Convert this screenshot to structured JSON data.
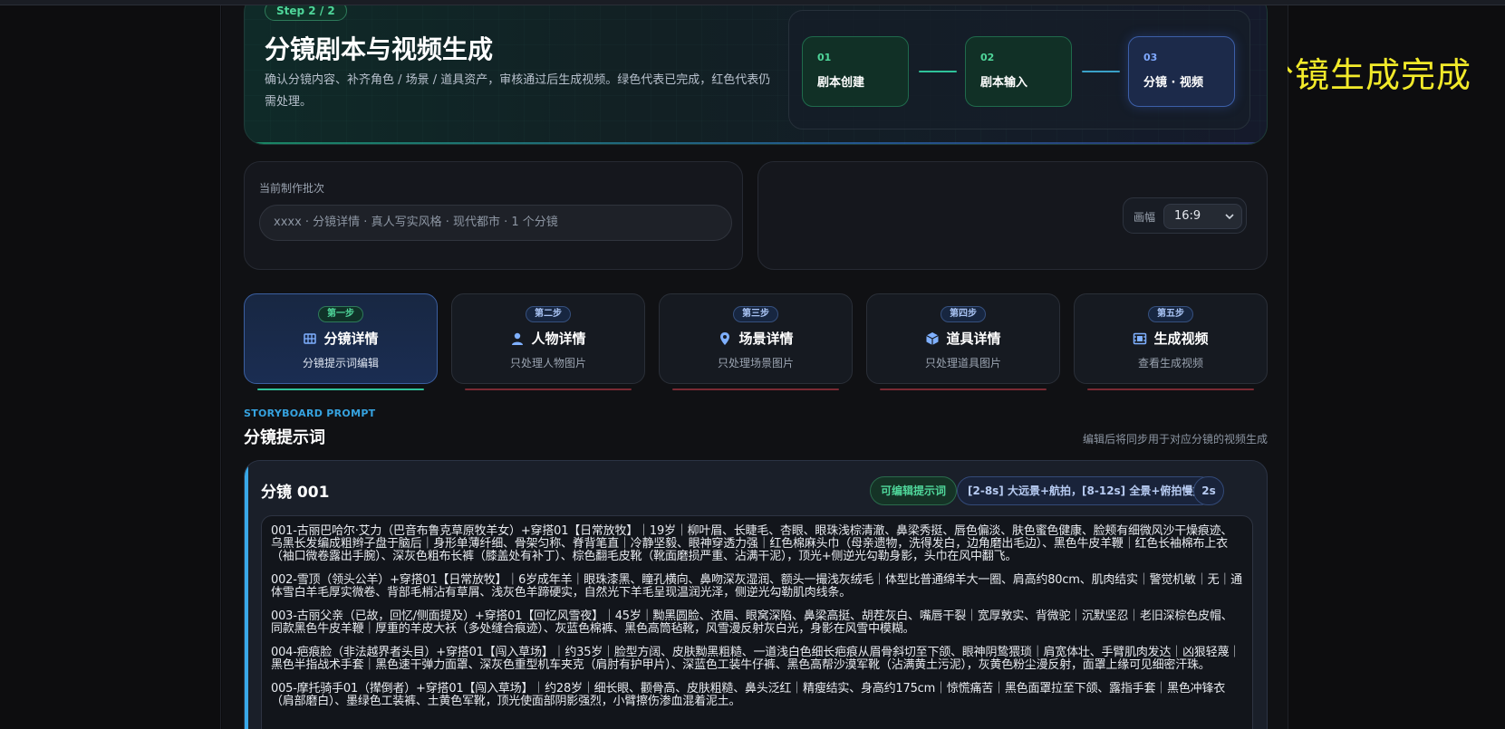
{
  "overlay_caption": "分镜生成完成",
  "hero": {
    "step_pill": "Step 2 / 2",
    "title": "分镜剧本与视频生成",
    "description": "确认分镜内容、补齐角色 / 场景 / 道具资产，审核通过后生成视频。绿色代表已完成，红色代表仍需处理。",
    "steps": [
      {
        "num": "01",
        "label": "剧本创建",
        "status": "done"
      },
      {
        "num": "02",
        "label": "剧本输入",
        "status": "done"
      },
      {
        "num": "03",
        "label": "分镜 · 视频",
        "status": "active"
      }
    ]
  },
  "batch": {
    "label": "当前制作批次",
    "value": "xxxx · 分镜详情 · 真人写实风格 · 现代都市 · 1 个分镜"
  },
  "ratio": {
    "label": "画幅",
    "selected": "16:9"
  },
  "tabs": [
    {
      "badge": "第一步",
      "title": "分镜详情",
      "subtitle": "分镜提示词编辑",
      "icon": "grid-icon",
      "active": true
    },
    {
      "badge": "第二步",
      "title": "人物详情",
      "subtitle": "只处理人物图片",
      "icon": "person-icon",
      "active": false
    },
    {
      "badge": "第三步",
      "title": "场景详情",
      "subtitle": "只处理场景图片",
      "icon": "location-pin-icon",
      "active": false
    },
    {
      "badge": "第四步",
      "title": "道具详情",
      "subtitle": "只处理道具图片",
      "icon": "cube-icon",
      "active": false
    },
    {
      "badge": "第五步",
      "title": "生成视频",
      "subtitle": "查看生成视频",
      "icon": "film-icon",
      "active": false
    }
  ],
  "section": {
    "eyebrow": "STORYBOARD PROMPT",
    "title": "分镜提示词",
    "note": "编辑后将同步用于对应分镜的视频生成"
  },
  "card": {
    "title": "分镜 001",
    "edit_chip": "可编辑提示词",
    "range_chip": "[2-8s] 大远景+航拍，[8-12s] 全景+俯拍慢推",
    "duration_chip": "2s",
    "paragraphs": [
      "001-古丽巴哈尔·艾力（巴音布鲁克草原牧羊女）+穿搭01【日常放牧】｜19岁｜柳叶眉、长睫毛、杏眼、眼珠浅棕清澈、鼻梁秀挺、唇色偏淡、肤色蜜色健康、脸颊有细微风沙干燥痕迹、乌黑长发编成粗辫子盘于脑后｜身形单薄纤细、骨架匀称、脊背笔直｜冷静坚毅、眼神穿透力强｜红色棉麻头巾（母亲遗物，洗得发白，边角磨出毛边）、黑色牛皮羊鞭｜红色长袖棉布上衣（袖口微卷露出手腕）、深灰色粗布长裤（膝盖处有补丁）、棕色翻毛皮靴（靴面磨损严重、沾满干泥），顶光+侧逆光勾勒身影，头巾在风中翻飞。",
      "002-雪顶（领头公羊）+穿搭01【日常放牧】｜6岁成年羊｜眼珠漆黑、瞳孔横向、鼻吻深灰湿润、额头一撮浅灰绒毛｜体型比普通绵羊大一圈、肩高约80cm、肌肉结实｜警觉机敏｜无｜通体雪白羊毛厚实微卷、背部毛梢沾有草屑、浅灰色羊蹄硬实，自然光下羊毛呈现温润光泽，侧逆光勾勒肌肉线条。",
      "003-古丽父亲（已故，回忆/侧面提及）+穿搭01【回忆风雪夜】｜45岁｜黝黑圆脸、浓眉、眼窝深陷、鼻梁高挺、胡茬灰白、嘴唇干裂｜宽厚敦实、背微驼｜沉默坚忍｜老旧深棕色皮帽、同款黑色牛皮羊鞭｜厚重的羊皮大袄（多处缝合痕迹）、灰蓝色棉裤、黑色高筒毡靴，风雪漫反射灰白光，身影在风雪中模糊。",
      "004-疤痕脸（非法越界者头目）+穿搭01【闯入草场】｜约35岁｜脸型方阔、皮肤黝黑粗糙、一道浅白色细长疤痕从眉骨斜切至下颌、眼神阴鸷猥琐｜肩宽体壮、手臂肌肉发达｜凶狠轻蔑｜黑色半指战术手套｜黑色速干弹力面罩、深灰色重型机车夹克（肩肘有护甲片）、深蓝色工装牛仔裤、黑色高帮沙漠军靴（沾满黄土污泥），灰黄色粉尘漫反射，面罩上缘可见细密汗珠。",
      "005-摩托骑手01（撵倒者）+穿搭01【闯入草场】｜约28岁｜细长眼、颧骨高、皮肤粗糙、鼻头泛红｜精瘦结实、身高约175cm｜惊慌痛苦｜黑色面罩拉至下颌、露指手套｜黑色冲锋衣（肩部磨白）、墨绿色工装裤、土黄色军靴，顶光使面部阴影强烈，小臂擦伤渗血混着泥土。"
    ]
  },
  "colors": {
    "accent_green": "#4fd69a",
    "accent_blue": "#38a8e8",
    "pending_red": "#7a2a33",
    "overlay_yellow": "#f2ea2a"
  }
}
